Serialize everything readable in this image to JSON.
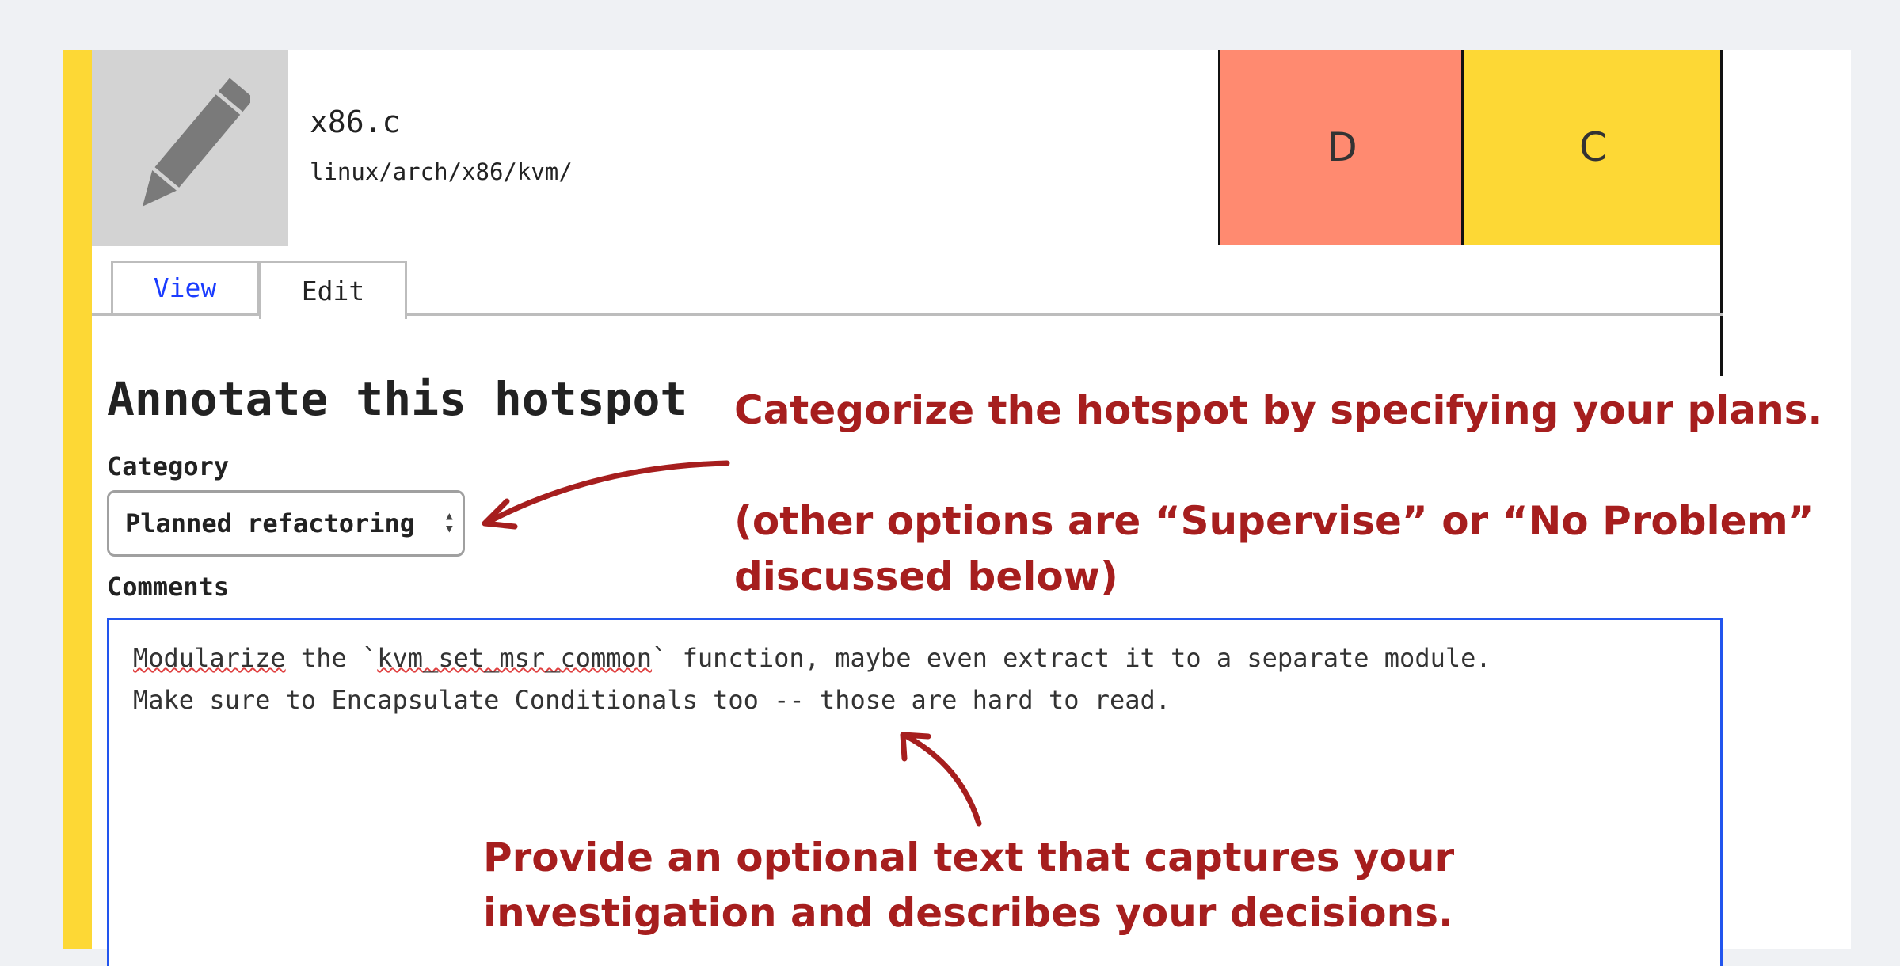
{
  "file": {
    "name": "x86.c",
    "path": "linux/arch/x86/kvm/",
    "icon": "pencil-icon"
  },
  "grades": [
    {
      "label": "D",
      "color": "#ff8a70"
    },
    {
      "label": "C",
      "color": "#fdd835"
    }
  ],
  "tabs": [
    {
      "label": "View"
    },
    {
      "label": "Edit"
    }
  ],
  "form": {
    "title": "Annotate this hotspot",
    "category_label": "Category",
    "category_value": "Planned refactoring",
    "comments_label": "Comments",
    "comments_line1_prefix": "",
    "comments_word1": "Modularize",
    "comments_mid": " the `",
    "comments_word2": "kvm_set_msr_common",
    "comments_rest": "` function, maybe even extract it to a separate module.",
    "comments_line2": "Make sure to Encapsulate Conditionals too -- those are hard to read."
  },
  "annotations": {
    "a1": "Categorize the hotspot by specifying your plans.",
    "a2": "(other options are “Supervise” or “No Problem” discussed below)",
    "a3": "Provide an optional text that captures your investigation and describes your decisions."
  },
  "colors": {
    "accent": "#fdd835",
    "annotation": "#a61e1e",
    "link": "#1a3cff",
    "focus_border": "#2255ee"
  }
}
